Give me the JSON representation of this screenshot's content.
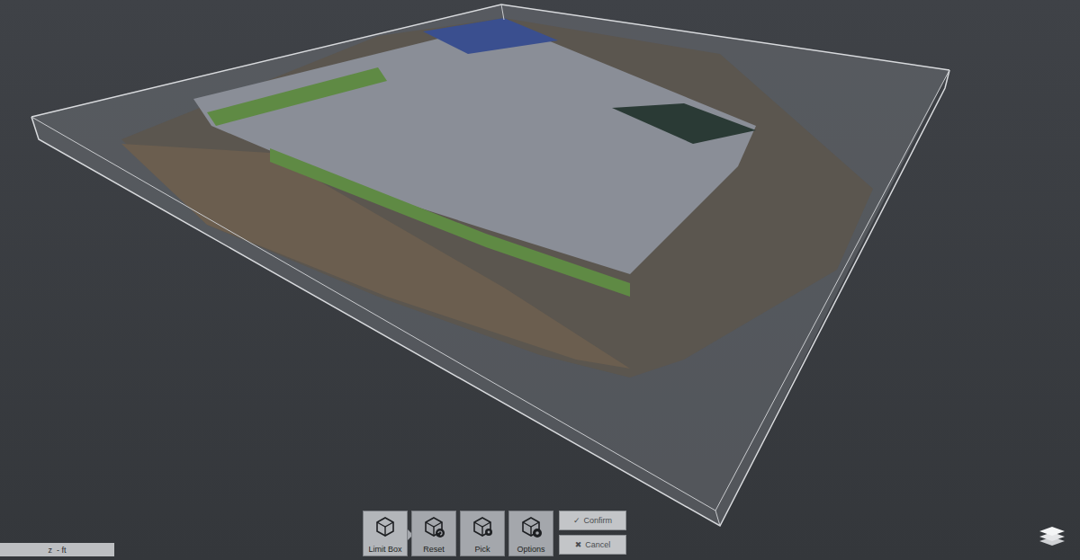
{
  "toolbar": {
    "tools": [
      {
        "label": "Limit Box",
        "selected": true
      },
      {
        "label": "Reset",
        "selected": false
      },
      {
        "label": "Pick",
        "selected": false
      },
      {
        "label": "Options",
        "selected": false
      }
    ],
    "actions": [
      {
        "label": "Confirm",
        "icon": "✓"
      },
      {
        "label": "Cancel",
        "icon": "✖"
      }
    ]
  },
  "status_field": {
    "text": "z  - ft"
  }
}
